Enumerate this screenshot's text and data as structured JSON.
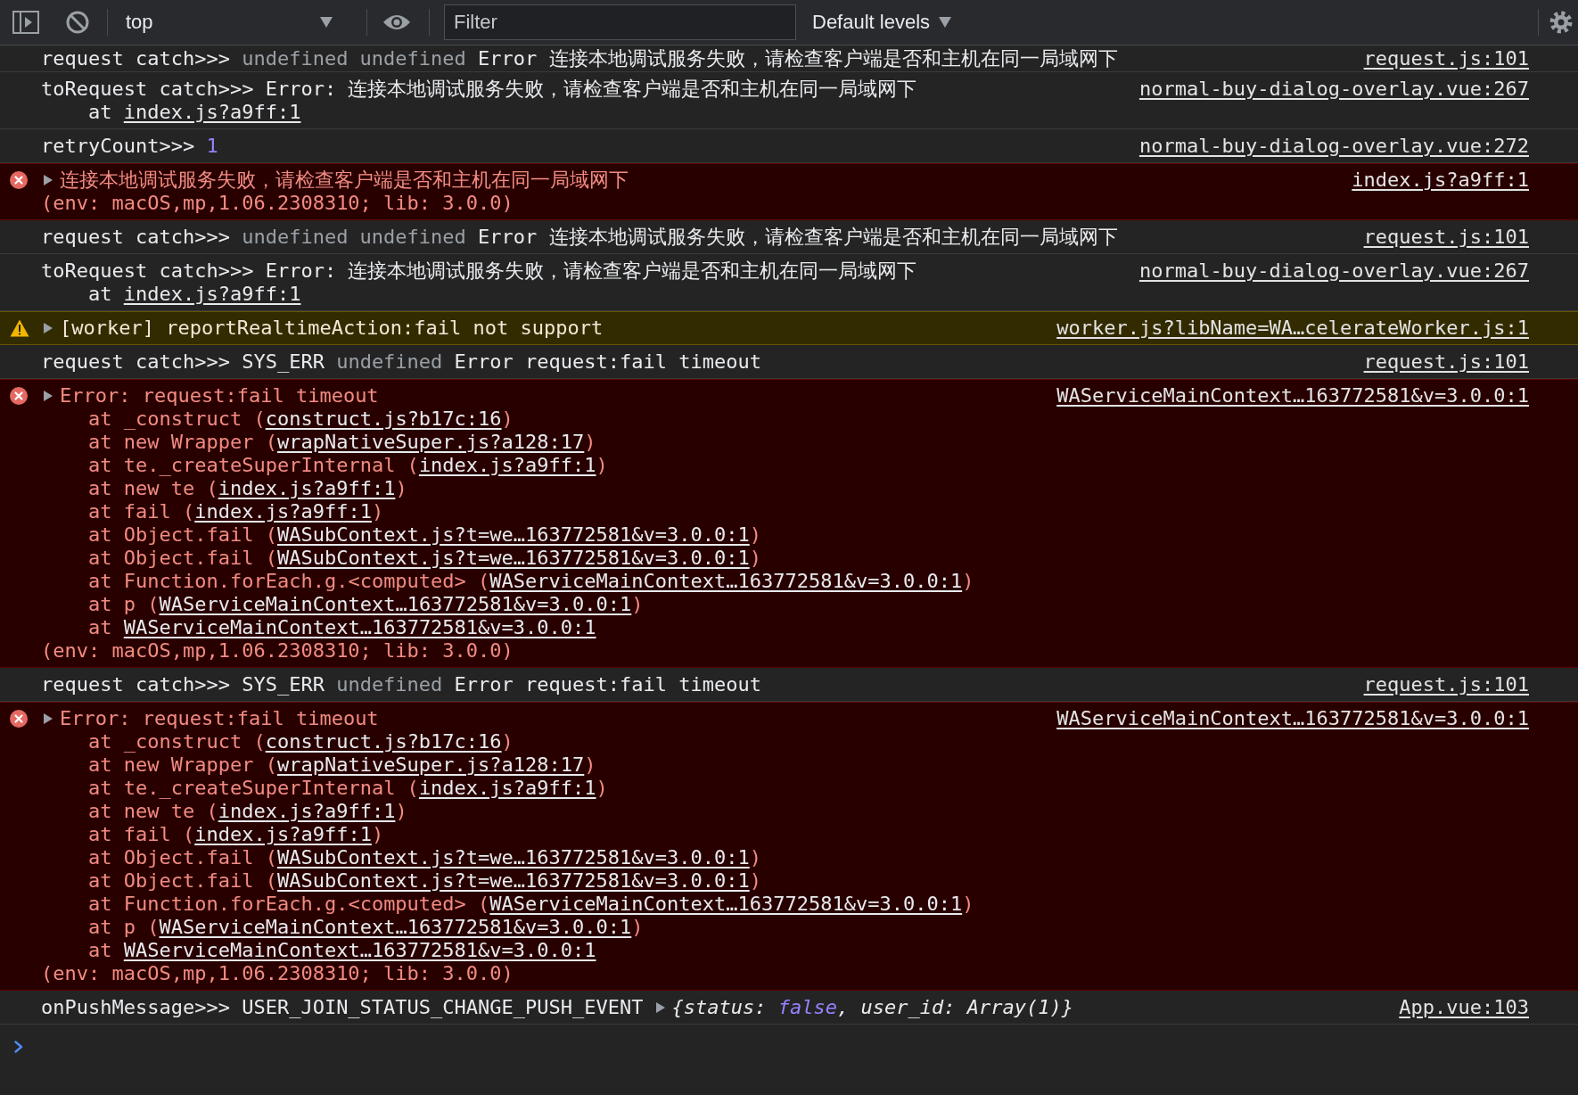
{
  "toolbar": {
    "context": {
      "value": "top"
    },
    "filter": {
      "placeholder": "Filter"
    },
    "levels": {
      "label": "Default levels"
    }
  },
  "messages": [
    {
      "kind": "log",
      "lines": [
        {
          "kind": "head",
          "segments": [
            {
              "kind": "text",
              "text": "request catch>>> "
            },
            {
              "kind": "dim",
              "text": "undefined undefined"
            },
            {
              "kind": "text",
              "text": " Error 连接本地调试服务失败，请检查客户端是否和主机在同一局域网下"
            }
          ]
        }
      ],
      "source": "request.js:101"
    },
    {
      "kind": "log",
      "lines": [
        {
          "kind": "head",
          "segments": [
            {
              "kind": "text",
              "text": "toRequest catch>>> Error: 连接本地调试服务失败，请检查客户端是否和主机在同一局域网下"
            }
          ]
        },
        {
          "kind": "frame",
          "segments": [
            {
              "kind": "text",
              "text": "at "
            },
            {
              "kind": "link",
              "text": "index.js?a9ff:1"
            }
          ]
        }
      ],
      "source": "normal-buy-dialog-overlay.vue:267"
    },
    {
      "kind": "log",
      "lines": [
        {
          "kind": "head",
          "segments": [
            {
              "kind": "text",
              "text": "retryCount>>> "
            },
            {
              "kind": "number",
              "text": "1"
            }
          ]
        }
      ],
      "source": "normal-buy-dialog-overlay.vue:272"
    },
    {
      "kind": "error",
      "lines": [
        {
          "kind": "head",
          "segments": [
            {
              "kind": "toggle",
              "expanded": false
            },
            {
              "kind": "text",
              "text": "连接本地调试服务失败，请检查客户端是否和主机在同一局域网下"
            }
          ]
        },
        {
          "kind": "env",
          "segments": [
            {
              "kind": "text",
              "text": "(env: macOS,mp,1.06.2308310; lib: 3.0.0)"
            }
          ]
        }
      ],
      "source": "index.js?a9ff:1"
    },
    {
      "kind": "log",
      "lines": [
        {
          "kind": "head",
          "segments": [
            {
              "kind": "text",
              "text": "request catch>>> "
            },
            {
              "kind": "dim",
              "text": "undefined undefined"
            },
            {
              "kind": "text",
              "text": " Error 连接本地调试服务失败，请检查客户端是否和主机在同一局域网下"
            }
          ]
        }
      ],
      "source": "request.js:101"
    },
    {
      "kind": "log",
      "lines": [
        {
          "kind": "head",
          "segments": [
            {
              "kind": "text",
              "text": "toRequest catch>>> Error: 连接本地调试服务失败，请检查客户端是否和主机在同一局域网下"
            }
          ]
        },
        {
          "kind": "frame",
          "segments": [
            {
              "kind": "text",
              "text": "at "
            },
            {
              "kind": "link",
              "text": "index.js?a9ff:1"
            }
          ]
        }
      ],
      "source": "normal-buy-dialog-overlay.vue:267"
    },
    {
      "kind": "warning",
      "lines": [
        {
          "kind": "head",
          "segments": [
            {
              "kind": "toggle",
              "expanded": false
            },
            {
              "kind": "text",
              "text": "[worker] reportRealtimeAction:fail not support"
            }
          ]
        }
      ],
      "source": "worker.js?libName=WA…celerateWorker.js:1"
    },
    {
      "kind": "log",
      "lines": [
        {
          "kind": "head",
          "segments": [
            {
              "kind": "text",
              "text": "request catch>>> SYS_ERR "
            },
            {
              "kind": "dim",
              "text": "undefined"
            },
            {
              "kind": "text",
              "text": " Error request:fail timeout"
            }
          ]
        }
      ],
      "source": "request.js:101"
    },
    {
      "kind": "error",
      "lines": [
        {
          "kind": "head",
          "segments": [
            {
              "kind": "toggle",
              "expanded": false
            },
            {
              "kind": "text",
              "text": "Error: request:fail timeout"
            }
          ]
        },
        {
          "kind": "frame",
          "segments": [
            {
              "kind": "text",
              "text": "at _construct ("
            },
            {
              "kind": "link",
              "text": "construct.js?b17c:16"
            },
            {
              "kind": "text",
              "text": ")"
            }
          ]
        },
        {
          "kind": "frame",
          "segments": [
            {
              "kind": "text",
              "text": "at new Wrapper ("
            },
            {
              "kind": "link",
              "text": "wrapNativeSuper.js?a128:17"
            },
            {
              "kind": "text",
              "text": ")"
            }
          ]
        },
        {
          "kind": "frame",
          "segments": [
            {
              "kind": "text",
              "text": "at te._createSuperInternal ("
            },
            {
              "kind": "link",
              "text": "index.js?a9ff:1"
            },
            {
              "kind": "text",
              "text": ")"
            }
          ]
        },
        {
          "kind": "frame",
          "segments": [
            {
              "kind": "text",
              "text": "at new te ("
            },
            {
              "kind": "link",
              "text": "index.js?a9ff:1"
            },
            {
              "kind": "text",
              "text": ")"
            }
          ]
        },
        {
          "kind": "frame",
          "segments": [
            {
              "kind": "text",
              "text": "at fail ("
            },
            {
              "kind": "link",
              "text": "index.js?a9ff:1"
            },
            {
              "kind": "text",
              "text": ")"
            }
          ]
        },
        {
          "kind": "frame",
          "segments": [
            {
              "kind": "text",
              "text": "at Object.fail ("
            },
            {
              "kind": "link",
              "text": "WASubContext.js?t=we…163772581&v=3.0.0:1"
            },
            {
              "kind": "text",
              "text": ")"
            }
          ]
        },
        {
          "kind": "frame",
          "segments": [
            {
              "kind": "text",
              "text": "at Object.fail ("
            },
            {
              "kind": "link",
              "text": "WASubContext.js?t=we…163772581&v=3.0.0:1"
            },
            {
              "kind": "text",
              "text": ")"
            }
          ]
        },
        {
          "kind": "frame",
          "segments": [
            {
              "kind": "text",
              "text": "at Function.forEach.g.<computed> ("
            },
            {
              "kind": "link",
              "text": "WAServiceMainContext…163772581&v=3.0.0:1"
            },
            {
              "kind": "text",
              "text": ")"
            }
          ]
        },
        {
          "kind": "frame",
          "segments": [
            {
              "kind": "text",
              "text": "at p ("
            },
            {
              "kind": "link",
              "text": "WAServiceMainContext…163772581&v=3.0.0:1"
            },
            {
              "kind": "text",
              "text": ")"
            }
          ]
        },
        {
          "kind": "frame",
          "segments": [
            {
              "kind": "text",
              "text": "at "
            },
            {
              "kind": "link",
              "text": "WAServiceMainContext…163772581&v=3.0.0:1"
            }
          ]
        },
        {
          "kind": "env",
          "segments": [
            {
              "kind": "text",
              "text": "(env: macOS,mp,1.06.2308310; lib: 3.0.0)"
            }
          ]
        }
      ],
      "source": "WAServiceMainContext…163772581&v=3.0.0:1"
    },
    {
      "kind": "log",
      "lines": [
        {
          "kind": "head",
          "segments": [
            {
              "kind": "text",
              "text": "request catch>>> SYS_ERR "
            },
            {
              "kind": "dim",
              "text": "undefined"
            },
            {
              "kind": "text",
              "text": " Error request:fail timeout"
            }
          ]
        }
      ],
      "source": "request.js:101"
    },
    {
      "kind": "error",
      "lines": [
        {
          "kind": "head",
          "segments": [
            {
              "kind": "toggle",
              "expanded": false
            },
            {
              "kind": "text",
              "text": "Error: request:fail timeout"
            }
          ]
        },
        {
          "kind": "frame",
          "segments": [
            {
              "kind": "text",
              "text": "at _construct ("
            },
            {
              "kind": "link",
              "text": "construct.js?b17c:16"
            },
            {
              "kind": "text",
              "text": ")"
            }
          ]
        },
        {
          "kind": "frame",
          "segments": [
            {
              "kind": "text",
              "text": "at new Wrapper ("
            },
            {
              "kind": "link",
              "text": "wrapNativeSuper.js?a128:17"
            },
            {
              "kind": "text",
              "text": ")"
            }
          ]
        },
        {
          "kind": "frame",
          "segments": [
            {
              "kind": "text",
              "text": "at te._createSuperInternal ("
            },
            {
              "kind": "link",
              "text": "index.js?a9ff:1"
            },
            {
              "kind": "text",
              "text": ")"
            }
          ]
        },
        {
          "kind": "frame",
          "segments": [
            {
              "kind": "text",
              "text": "at new te ("
            },
            {
              "kind": "link",
              "text": "index.js?a9ff:1"
            },
            {
              "kind": "text",
              "text": ")"
            }
          ]
        },
        {
          "kind": "frame",
          "segments": [
            {
              "kind": "text",
              "text": "at fail ("
            },
            {
              "kind": "link",
              "text": "index.js?a9ff:1"
            },
            {
              "kind": "text",
              "text": ")"
            }
          ]
        },
        {
          "kind": "frame",
          "segments": [
            {
              "kind": "text",
              "text": "at Object.fail ("
            },
            {
              "kind": "link",
              "text": "WASubContext.js?t=we…163772581&v=3.0.0:1"
            },
            {
              "kind": "text",
              "text": ")"
            }
          ]
        },
        {
          "kind": "frame",
          "segments": [
            {
              "kind": "text",
              "text": "at Object.fail ("
            },
            {
              "kind": "link",
              "text": "WASubContext.js?t=we…163772581&v=3.0.0:1"
            },
            {
              "kind": "text",
              "text": ")"
            }
          ]
        },
        {
          "kind": "frame",
          "segments": [
            {
              "kind": "text",
              "text": "at Function.forEach.g.<computed> ("
            },
            {
              "kind": "link",
              "text": "WAServiceMainContext…163772581&v=3.0.0:1"
            },
            {
              "kind": "text",
              "text": ")"
            }
          ]
        },
        {
          "kind": "frame",
          "segments": [
            {
              "kind": "text",
              "text": "at p ("
            },
            {
              "kind": "link",
              "text": "WAServiceMainContext…163772581&v=3.0.0:1"
            },
            {
              "kind": "text",
              "text": ")"
            }
          ]
        },
        {
          "kind": "frame",
          "segments": [
            {
              "kind": "text",
              "text": "at "
            },
            {
              "kind": "link",
              "text": "WAServiceMainContext…163772581&v=3.0.0:1"
            }
          ]
        },
        {
          "kind": "env",
          "segments": [
            {
              "kind": "text",
              "text": "(env: macOS,mp,1.06.2308310; lib: 3.0.0)"
            }
          ]
        }
      ],
      "source": "WAServiceMainContext…163772581&v=3.0.0:1"
    },
    {
      "kind": "log",
      "lines": [
        {
          "kind": "head",
          "segments": [
            {
              "kind": "text",
              "text": "onPushMessage>>> USER_JOIN_STATUS_CHANGE_PUSH_EVENT"
            },
            {
              "kind": "toggle",
              "expanded": false
            },
            {
              "kind": "object",
              "text": "{status: "
            },
            {
              "kind": "value",
              "text": "false"
            },
            {
              "kind": "object",
              "text": ", user_id: Array(1)}"
            }
          ]
        }
      ],
      "source": "App.vue:103"
    }
  ]
}
